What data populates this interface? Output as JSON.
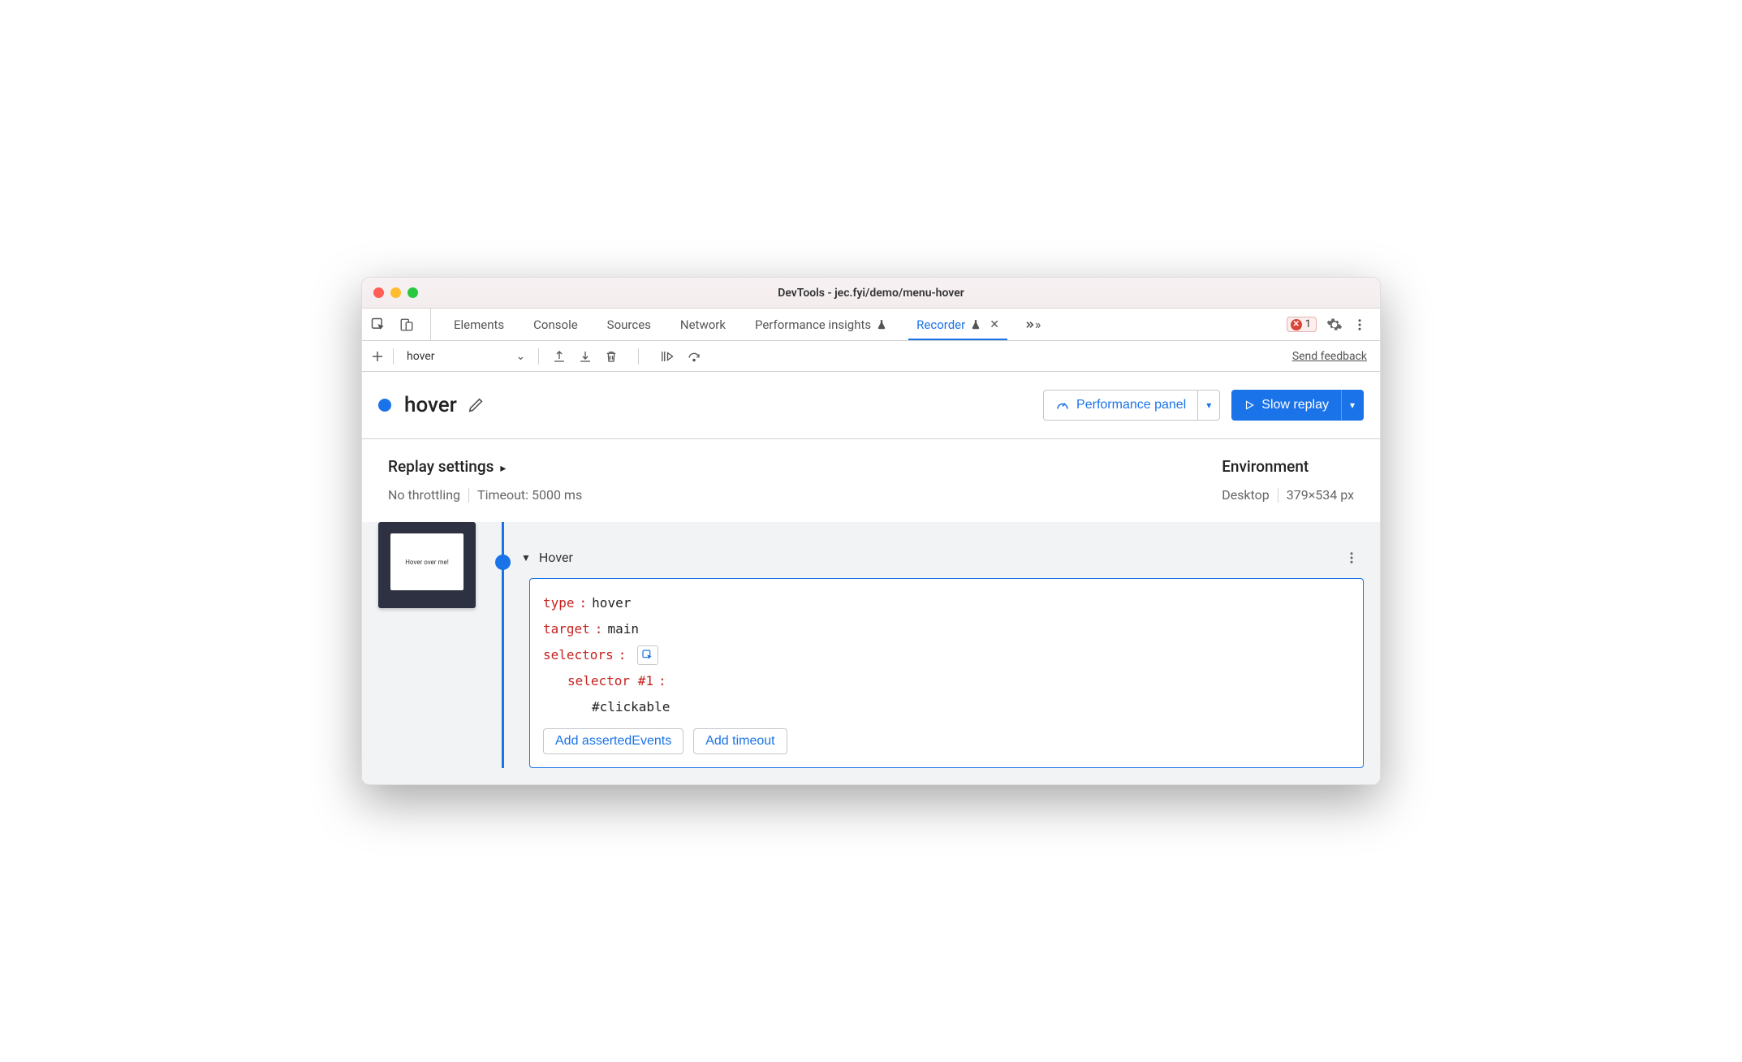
{
  "window": {
    "title": "DevTools - jec.fyi/demo/menu-hover"
  },
  "tabs": {
    "items": [
      "Elements",
      "Console",
      "Sources",
      "Network",
      "Performance insights",
      "Recorder"
    ],
    "active_index": 5
  },
  "error_count": "1",
  "toolbar": {
    "recording_select_value": "hover",
    "feedback_link": "Send feedback"
  },
  "header": {
    "recording_name": "hover",
    "perf_button": "Performance panel",
    "replay_button": "Slow replay"
  },
  "settings": {
    "replay_title": "Replay settings",
    "throttling": "No throttling",
    "timeout": "Timeout: 5000 ms",
    "env_title": "Environment",
    "device": "Desktop",
    "dimensions": "379×534 px"
  },
  "thumbnail": {
    "label": "Hover over me!"
  },
  "step": {
    "title": "Hover",
    "props": {
      "type_label": "type",
      "type_value": "hover",
      "target_label": "target",
      "target_value": "main",
      "selectors_label": "selectors",
      "selector1_label": "selector #1",
      "selector1_value": "#clickable"
    },
    "add_asserted": "Add assertedEvents",
    "add_timeout": "Add timeout"
  }
}
